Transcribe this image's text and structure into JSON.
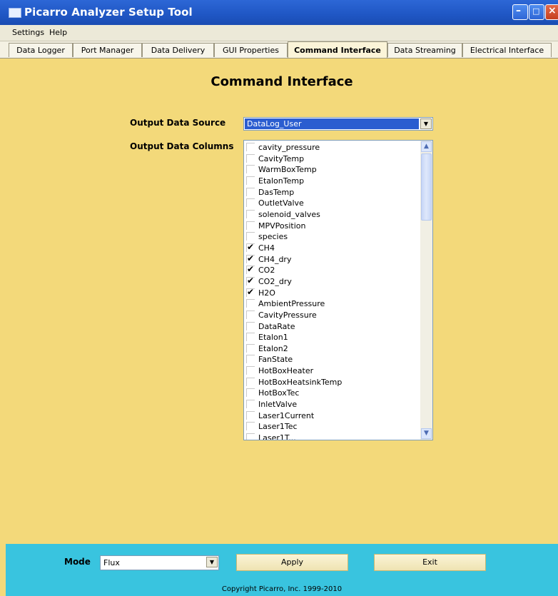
{
  "window": {
    "title": "Picarro Analyzer Setup Tool"
  },
  "menu": [
    "Settings",
    "Help"
  ],
  "tabs": [
    "Data Logger",
    "Port Manager",
    "Data Delivery",
    "GUI Properties",
    "Command Interface",
    "Data Streaming",
    "Electrical Interface"
  ],
  "active_tab": "Command Interface",
  "page": {
    "heading": "Command Interface",
    "source_label": "Output Data Source",
    "source_value": "DataLog_User",
    "columns_label": "Output Data Columns"
  },
  "columns": [
    {
      "name": "cavity_pressure",
      "checked": false
    },
    {
      "name": "CavityTemp",
      "checked": false
    },
    {
      "name": "WarmBoxTemp",
      "checked": false
    },
    {
      "name": "EtalonTemp",
      "checked": false
    },
    {
      "name": "DasTemp",
      "checked": false
    },
    {
      "name": "OutletValve",
      "checked": false
    },
    {
      "name": "solenoid_valves",
      "checked": false
    },
    {
      "name": "MPVPosition",
      "checked": false
    },
    {
      "name": "species",
      "checked": false
    },
    {
      "name": "CH4",
      "checked": true
    },
    {
      "name": "CH4_dry",
      "checked": true
    },
    {
      "name": "CO2",
      "checked": true
    },
    {
      "name": "CO2_dry",
      "checked": true
    },
    {
      "name": "H2O",
      "checked": true
    },
    {
      "name": "AmbientPressure",
      "checked": false
    },
    {
      "name": "CavityPressure",
      "checked": false
    },
    {
      "name": "DataRate",
      "checked": false
    },
    {
      "name": "Etalon1",
      "checked": false
    },
    {
      "name": "Etalon2",
      "checked": false
    },
    {
      "name": "FanState",
      "checked": false
    },
    {
      "name": "HotBoxHeater",
      "checked": false
    },
    {
      "name": "HotBoxHeatsinkTemp",
      "checked": false
    },
    {
      "name": "HotBoxTec",
      "checked": false
    },
    {
      "name": "InletValve",
      "checked": false
    },
    {
      "name": "Laser1Current",
      "checked": false
    },
    {
      "name": "Laser1Tec",
      "checked": false
    },
    {
      "name": "Laser1T...",
      "checked": false
    }
  ],
  "bottom": {
    "mode_label": "Mode",
    "mode_value": "Flux",
    "apply": "Apply",
    "exit": "Exit",
    "copyright": "Copyright Picarro, Inc. 1999-2010"
  }
}
